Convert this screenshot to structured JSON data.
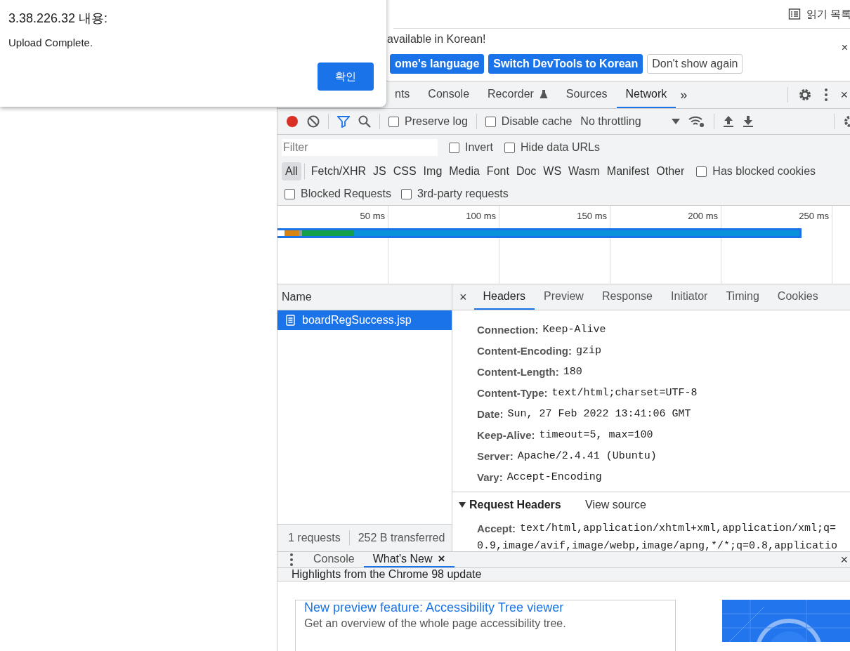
{
  "browser_bar": {
    "reading_list": "읽기 목록"
  },
  "dialog": {
    "title": "3.38.226.32 내용:",
    "message": "Upload Complete.",
    "ok": "확인"
  },
  "infobar": {
    "message": "available in Korean!",
    "close": "×",
    "buttons": [
      {
        "label": "ome's language",
        "primary": true
      },
      {
        "label": "Switch DevTools to Korean",
        "primary": true
      },
      {
        "label": "Don't show again",
        "primary": false
      }
    ]
  },
  "tabs": [
    {
      "label": "nts",
      "selected": false,
      "beta": false
    },
    {
      "label": "Console",
      "selected": false,
      "beta": false
    },
    {
      "label": "Recorder",
      "selected": false,
      "beta": true
    },
    {
      "label": "Sources",
      "selected": false,
      "beta": false
    },
    {
      "label": "Network",
      "selected": true,
      "beta": false
    }
  ],
  "more_tabs": "»",
  "devtools_close": "×",
  "toolbar": {
    "recording": true,
    "filter_active": true,
    "throttling": "No throttling",
    "options": [
      {
        "label": "Preserve log",
        "checked": false
      },
      {
        "label": "Disable cache",
        "checked": false
      }
    ]
  },
  "filter": {
    "placeholder": "Filter",
    "options": [
      {
        "label": "Invert",
        "checked": false
      },
      {
        "label": "Hide data URLs",
        "checked": false
      }
    ]
  },
  "types": [
    {
      "label": "All",
      "selected": true
    },
    {
      "label": "Fetch/XHR",
      "selected": false
    },
    {
      "label": "JS",
      "selected": false
    },
    {
      "label": "CSS",
      "selected": false
    },
    {
      "label": "Img",
      "selected": false
    },
    {
      "label": "Media",
      "selected": false
    },
    {
      "label": "Font",
      "selected": false
    },
    {
      "label": "Doc",
      "selected": false
    },
    {
      "label": "WS",
      "selected": false
    },
    {
      "label": "Wasm",
      "selected": false
    },
    {
      "label": "Manifest",
      "selected": false
    },
    {
      "label": "Other",
      "selected": false
    }
  ],
  "has_blocked_cookies": {
    "label": "Has blocked cookies",
    "checked": false
  },
  "extra_options": [
    {
      "label": "Blocked Requests",
      "checked": false
    },
    {
      "label": "3rd-party requests",
      "checked": false
    }
  ],
  "overview": {
    "ticks": [
      "50 ms",
      "100 ms",
      "150 ms",
      "200 ms",
      "250 ms"
    ]
  },
  "requests": {
    "column": "Name",
    "rows": [
      {
        "name": "boardRegSuccess.jsp",
        "selected": true
      }
    ],
    "status": [
      "1 requests",
      "252 B transferred"
    ]
  },
  "details": {
    "close": "×",
    "tabs": [
      {
        "label": "Headers",
        "selected": true
      },
      {
        "label": "Preview",
        "selected": false
      },
      {
        "label": "Response",
        "selected": false
      },
      {
        "label": "Initiator",
        "selected": false
      },
      {
        "label": "Timing",
        "selected": false
      },
      {
        "label": "Cookies",
        "selected": false
      }
    ],
    "response_headers": [
      {
        "name": "Connection:",
        "value": "Keep-Alive"
      },
      {
        "name": "Content-Encoding:",
        "value": "gzip"
      },
      {
        "name": "Content-Length:",
        "value": "180"
      },
      {
        "name": "Content-Type:",
        "value": "text/html;charset=UTF-8"
      },
      {
        "name": "Date:",
        "value": "Sun, 27 Feb 2022 13:41:06 GMT"
      },
      {
        "name": "Keep-Alive:",
        "value": "timeout=5, max=100"
      },
      {
        "name": "Server:",
        "value": "Apache/2.4.41 (Ubuntu)"
      },
      {
        "name": "Vary:",
        "value": "Accept-Encoding"
      }
    ],
    "request_headers": {
      "title": "Request Headers",
      "expanded": true,
      "view_source": "View source",
      "rows": [
        {
          "name": "Accept:",
          "value": "text/html,application/xhtml+xml,application/xml;q=",
          "continuation": "0.9,image/avif,image/webp,image/apng,*/*;q=0.8,applicatio"
        }
      ]
    }
  },
  "drawer": {
    "close": "×",
    "heading": "Highlights from the Chrome 98 update",
    "tabs": [
      {
        "label": "Console",
        "selected": false
      },
      {
        "label": "What's New",
        "selected": true,
        "close": "×"
      }
    ],
    "card": {
      "title": "New preview feature: Accessibility Tree viewer",
      "text": "Get an overview of the whole page accessibility tree."
    }
  }
}
